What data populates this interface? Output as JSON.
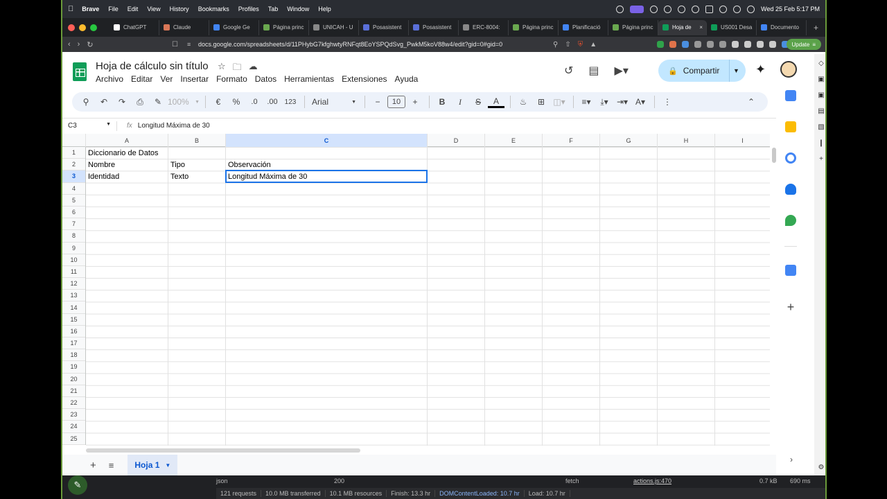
{
  "menubar": {
    "app": "Brave",
    "items": [
      "File",
      "Edit",
      "View",
      "History",
      "Bookmarks",
      "Profiles",
      "Tab",
      "Window",
      "Help"
    ],
    "clock": "Wed 25 Feb  5:17 PM"
  },
  "tabs": [
    {
      "label": "ChatGPT",
      "color": "#ffffff"
    },
    {
      "label": "Claude",
      "color": "#d97757"
    },
    {
      "label": "Google Ge",
      "color": "#4285f4"
    },
    {
      "label": "Página princ",
      "color": "#6aa84f"
    },
    {
      "label": "UNICAH - U",
      "color": "#888888"
    },
    {
      "label": "Posasistent",
      "color": "#5a6fd8"
    },
    {
      "label": "Posasistent",
      "color": "#5a6fd8"
    },
    {
      "label": "ERC-8004:",
      "color": "#888888"
    },
    {
      "label": "Página princ",
      "color": "#6aa84f"
    },
    {
      "label": "Planificació",
      "color": "#4285f4"
    },
    {
      "label": "Página princ",
      "color": "#6aa84f"
    },
    {
      "label": "Hoja de",
      "color": "#0f9d58",
      "active": true
    },
    {
      "label": "US001 Desa",
      "color": "#0f9d58"
    },
    {
      "label": "Documento",
      "color": "#4285f4"
    }
  ],
  "address": {
    "url": "docs.google.com/spreadsheets/d/11PHybG7kfghwtyRNFqt8EoYSPQdSvg_PwkM5koV88w4/edit?gid=0#gid=0",
    "update_label": "Update"
  },
  "sheet": {
    "title": "Hoja de cálculo sin título",
    "menus": [
      "Archivo",
      "Editar",
      "Ver",
      "Insertar",
      "Formato",
      "Datos",
      "Herramientas",
      "Extensiones",
      "Ayuda"
    ],
    "share_label": "Compartir",
    "toolbar": {
      "zoom": "100%",
      "currency": "€",
      "percent": "%",
      "dec_less": ".0",
      "dec_more": ".00",
      "numfmt": "123",
      "font": "Arial",
      "size": "10"
    },
    "formula_bar": {
      "cell_ref": "C3",
      "fx": "fx",
      "content": "Longitud Máxima de 30"
    },
    "columns": [
      "A",
      "B",
      "C",
      "D",
      "E",
      "F",
      "G",
      "H",
      "I"
    ],
    "selected_column": "C",
    "rows": [
      "1",
      "2",
      "3",
      "4",
      "5",
      "6",
      "7",
      "8",
      "9",
      "10",
      "11",
      "12",
      "13",
      "14",
      "15",
      "16",
      "17",
      "18",
      "19",
      "20",
      "21",
      "22",
      "23",
      "24",
      "25"
    ],
    "selected_row": "3",
    "cells": {
      "A1": "Diccionario de Datos",
      "A2": "Nombre",
      "B2": "Tipo",
      "C2": "Observación",
      "A3": "Identidad",
      "B3": "Texto",
      "C3": "Longitud Máxima de 30"
    },
    "sheet_tab": "Hoja 1"
  },
  "devtools": {
    "row1": {
      "name": "json",
      "status": "200",
      "type": "fetch",
      "initiator": "actions.js:470",
      "size": "0.7 kB",
      "time": "690 ms"
    },
    "row2": [
      "121 requests",
      "10.0 MB transferred",
      "10.1 MB resources",
      "Finish: 13.3 hr",
      "DOMContentLoaded: 10.7 hr",
      "Load: 10.7 hr"
    ]
  },
  "colors": {
    "accent": "#1a73e8",
    "share_bg": "#c2e7ff",
    "sheets_green": "#0f9d58",
    "toolbar_bg": "#edf2fa"
  }
}
